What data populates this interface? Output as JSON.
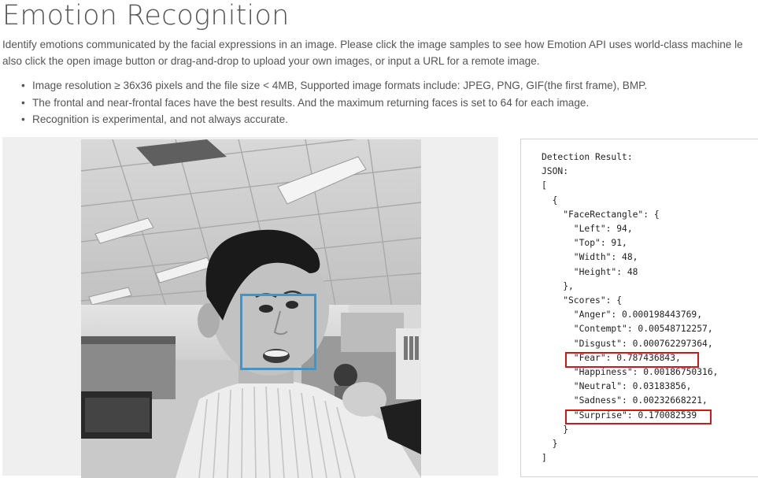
{
  "page": {
    "title": "Emotion Recognition",
    "intro_line1": "Identify emotions communicated by the facial expressions in an image. Please click the image samples to see how Emotion API uses world-class machine le",
    "intro_line2": "also click the open image button or drag-and-drop to upload your own images, or input a URL for a remote image.",
    "notes": [
      "Image resolution ≥ 36x36 pixels and the file size < 4MB, Supported image formats include: JPEG, PNG, GIF(the first frame), BMP.",
      "The frontal and near-frontal faces have the best results. And the maximum returning faces is set to 64 for each image.",
      "Recognition is experimental, and not always accurate."
    ]
  },
  "colors": {
    "face_box": "#2d9be0",
    "highlight": "#d01818",
    "panel_bg": "#efefef"
  },
  "result": {
    "lines": [
      "Detection Result:",
      "JSON:",
      "[",
      "  {",
      "    \"FaceRectangle\": {",
      "      \"Left\": 94,",
      "      \"Top\": 91,",
      "      \"Width\": 48,",
      "      \"Height\": 48",
      "    },",
      "    \"Scores\": {",
      "      \"Anger\": 0.000198443769,",
      "      \"Contempt\": 0.00548712257,",
      "      \"Disgust\": 0.000762297364,",
      "      \"Fear\": 0.787436843,",
      "      \"Happiness\": 0.00186750316,",
      "      \"Neutral\": 0.03183856,",
      "      \"Sadness\": 0.00232668221,",
      "      \"Surprise\": 0.170082539",
      "    }",
      "  }",
      "]"
    ]
  }
}
